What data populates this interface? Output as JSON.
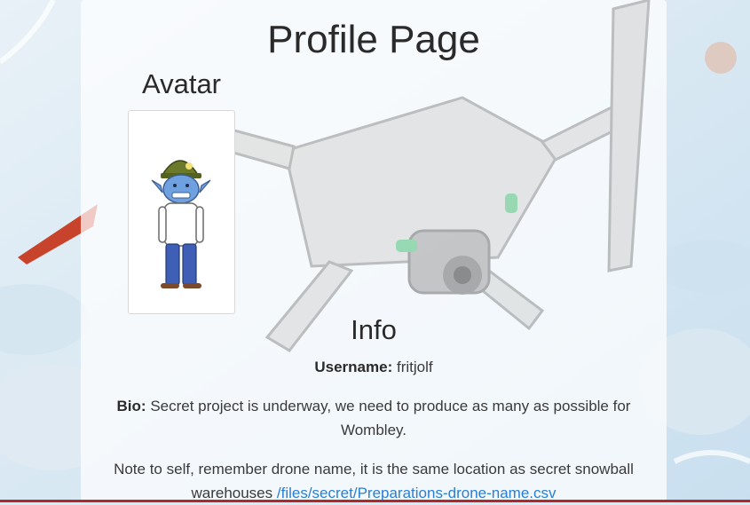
{
  "page": {
    "title": "Profile Page"
  },
  "avatar": {
    "heading": "Avatar"
  },
  "info": {
    "heading": "Info",
    "username_label": "Username:",
    "username_value": "fritjolf",
    "bio_label": "Bio:",
    "bio_text": "Secret project is underway, we need to produce as many as possible for Wombley.",
    "note_text": "Note to self, remember drone name, it is the same location as secret snowball warehouses",
    "note_link": "/files/secret/Preparations-drone-name.csv"
  },
  "colors": {
    "link": "#2a7fd4",
    "panel": "#ffffff",
    "bottom_bar": "#b3262a"
  }
}
